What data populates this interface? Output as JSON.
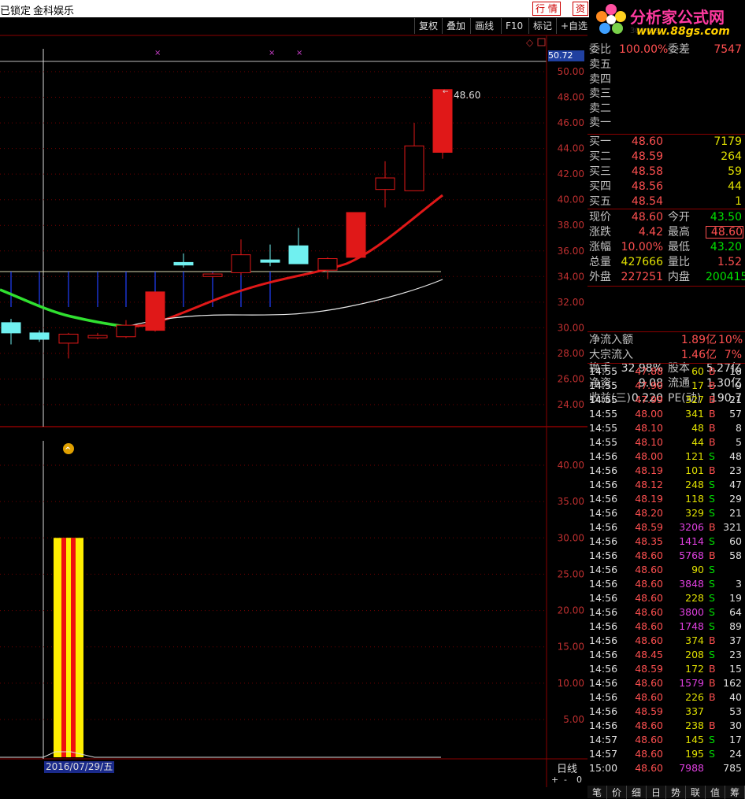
{
  "topbar": {
    "lock_text": "已锁定",
    "stock_name": "金科娱乐",
    "quote_btn": "行 情",
    "info_btn": "资"
  },
  "logo": {
    "title": "分析家公式网",
    "url": "www.88gs.com",
    "code": "300459"
  },
  "toolbar": {
    "items": [
      "复权",
      "叠加",
      "画线",
      "F10",
      "标记",
      "+自选"
    ]
  },
  "chart": {
    "indicator_value": "50.72",
    "last_price_label": "48.60",
    "price_axis": [
      "50.00",
      "48.00",
      "46.00",
      "44.00",
      "42.00",
      "40.00",
      "38.00",
      "36.00",
      "34.00",
      "32.00",
      "30.00",
      "28.00",
      "26.00",
      "24.00"
    ],
    "volume_axis": [
      "40.00",
      "35.00",
      "30.00",
      "25.00",
      "20.00",
      "15.00",
      "10.00",
      "5.00"
    ],
    "date_label": "2016/07/29/五",
    "period_label": "日线",
    "zoom_plus": "+",
    "zoom_minus": "-",
    "zoom_zero": "0"
  },
  "chart_data": {
    "type": "candlestick",
    "ylim": [
      22.5,
      51
    ],
    "candles": [
      {
        "o": 29.6,
        "c": 30.4,
        "h": 30.7,
        "l": 28.7,
        "color": "cyan"
      },
      {
        "o": 29.1,
        "c": 29.6,
        "h": 29.8,
        "l": 28.9,
        "color": "cyan"
      },
      {
        "o": 28.8,
        "c": 29.5,
        "h": 29.6,
        "l": 27.6,
        "color": "red-hollow"
      },
      {
        "o": 29.3,
        "c": 29.4,
        "h": 29.6,
        "l": 29.1,
        "color": "red-hollow"
      },
      {
        "o": 29.3,
        "c": 30.2,
        "h": 30.6,
        "l": 29.2,
        "color": "red-hollow"
      },
      {
        "o": 29.8,
        "c": 32.8,
        "h": 32.8,
        "l": 29.7,
        "color": "red-solid"
      },
      {
        "o": 34.9,
        "c": 35.1,
        "h": 35.8,
        "l": 34.7,
        "color": "cyan"
      },
      {
        "o": 34.0,
        "c": 34.2,
        "h": 34.3,
        "l": 33.9,
        "color": "red-hollow"
      },
      {
        "o": 34.3,
        "c": 35.7,
        "h": 36.9,
        "l": 34.1,
        "color": "red-hollow"
      },
      {
        "o": 35.2,
        "c": 35.3,
        "h": 36.5,
        "l": 34.8,
        "color": "cyan"
      },
      {
        "o": 35.0,
        "c": 36.4,
        "h": 37.8,
        "l": 35.0,
        "color": "cyan"
      },
      {
        "o": 34.5,
        "c": 35.4,
        "h": 35.5,
        "l": 33.8,
        "color": "red-hollow"
      },
      {
        "o": 35.5,
        "c": 39.0,
        "h": 39.0,
        "l": 35.4,
        "color": "red-solid"
      },
      {
        "o": 40.8,
        "c": 41.7,
        "h": 43.0,
        "l": 39.4,
        "color": "red-hollow"
      },
      {
        "o": 40.7,
        "c": 44.2,
        "h": 46.0,
        "l": 40.7,
        "color": "red-hollow"
      },
      {
        "o": 43.7,
        "c": 48.6,
        "h": 48.6,
        "l": 43.2,
        "color": "red-solid"
      }
    ],
    "volume": [
      {
        "value": 30.0,
        "colors": [
          "yellow",
          "red"
        ]
      }
    ]
  },
  "orderbook": {
    "ratio_label": "委比",
    "ratio_value": "100.00%",
    "diff_label": "委差",
    "diff_value": "7547",
    "sells": [
      {
        "label": "卖五",
        "price": "",
        "vol": ""
      },
      {
        "label": "卖四",
        "price": "",
        "vol": ""
      },
      {
        "label": "卖三",
        "price": "",
        "vol": ""
      },
      {
        "label": "卖二",
        "price": "",
        "vol": ""
      },
      {
        "label": "卖一",
        "price": "",
        "vol": ""
      }
    ],
    "buys": [
      {
        "label": "买一",
        "price": "48.60",
        "vol": "7179"
      },
      {
        "label": "买二",
        "price": "48.59",
        "vol": "264"
      },
      {
        "label": "买三",
        "price": "48.58",
        "vol": "59"
      },
      {
        "label": "买四",
        "price": "48.56",
        "vol": "44"
      },
      {
        "label": "买五",
        "price": "48.54",
        "vol": "1"
      }
    ]
  },
  "stats": [
    {
      "l1": "现价",
      "v1": "48.60",
      "c1": "red",
      "l2": "今开",
      "v2": "43.50",
      "c2": "green"
    },
    {
      "l1": "涨跌",
      "v1": "4.42",
      "c1": "red",
      "l2": "最高",
      "v2": "48.60",
      "c2": "red"
    },
    {
      "l1": "涨幅",
      "v1": "10.00%",
      "c1": "red",
      "l2": "最低",
      "v2": "43.20",
      "c2": "green"
    },
    {
      "l1": "总量",
      "v1": "427666",
      "c1": "yellow",
      "l2": "量比",
      "v2": "1.52",
      "c2": "red"
    },
    {
      "l1": "外盘",
      "v1": "227251",
      "c1": "red",
      "l2": "内盘",
      "v2": "200415",
      "c2": "green"
    },
    {
      "l1": "换手",
      "v1": "32.98%",
      "c1": "white",
      "l2": "股本",
      "v2": "5.27亿",
      "c2": "white"
    },
    {
      "l1": "净资",
      "v1": "9.08",
      "c1": "white",
      "l2": "流通",
      "v2": "1.30亿",
      "c2": "white"
    },
    {
      "l1": "收益(三)",
      "v1": "0.220",
      "c1": "white",
      "l2": "PE(动)",
      "v2": "190.7",
      "c2": "white"
    }
  ],
  "flows": [
    {
      "label": "净流入额",
      "value": "1.89亿",
      "pct": "10%"
    },
    {
      "label": "大宗流入",
      "value": "1.46亿",
      "pct": "7%"
    }
  ],
  "ticks": [
    {
      "t": "14:55",
      "p": "47.88",
      "v": "60",
      "s": "B",
      "n": "18",
      "vc": "yellow"
    },
    {
      "t": "14:55",
      "p": "47.90",
      "v": "17",
      "s": "B",
      "n": "9",
      "vc": "yellow"
    },
    {
      "t": "14:55",
      "p": "47.99",
      "v": "327",
      "s": "B",
      "n": "21",
      "vc": "yellow"
    },
    {
      "t": "14:55",
      "p": "48.00",
      "v": "341",
      "s": "B",
      "n": "57",
      "vc": "yellow"
    },
    {
      "t": "14:55",
      "p": "48.10",
      "v": "48",
      "s": "B",
      "n": "8",
      "vc": "yellow"
    },
    {
      "t": "14:55",
      "p": "48.10",
      "v": "44",
      "s": "B",
      "n": "5",
      "vc": "yellow"
    },
    {
      "t": "14:56",
      "p": "48.00",
      "v": "121",
      "s": "S",
      "n": "48",
      "vc": "yellow"
    },
    {
      "t": "14:56",
      "p": "48.19",
      "v": "101",
      "s": "B",
      "n": "23",
      "vc": "yellow"
    },
    {
      "t": "14:56",
      "p": "48.12",
      "v": "248",
      "s": "S",
      "n": "47",
      "vc": "yellow"
    },
    {
      "t": "14:56",
      "p": "48.19",
      "v": "118",
      "s": "S",
      "n": "29",
      "vc": "yellow"
    },
    {
      "t": "14:56",
      "p": "48.20",
      "v": "329",
      "s": "S",
      "n": "21",
      "vc": "yellow"
    },
    {
      "t": "14:56",
      "p": "48.59",
      "v": "3206",
      "s": "B",
      "n": "321",
      "vc": "mag"
    },
    {
      "t": "14:56",
      "p": "48.35",
      "v": "1414",
      "s": "S",
      "n": "60",
      "vc": "mag"
    },
    {
      "t": "14:56",
      "p": "48.60",
      "v": "5768",
      "s": "B",
      "n": "58",
      "vc": "mag"
    },
    {
      "t": "14:56",
      "p": "48.60",
      "v": "90",
      "s": "S",
      "n": "",
      "vc": "yellow"
    },
    {
      "t": "14:56",
      "p": "48.60",
      "v": "3848",
      "s": "S",
      "n": "3",
      "vc": "mag"
    },
    {
      "t": "14:56",
      "p": "48.60",
      "v": "228",
      "s": "S",
      "n": "19",
      "vc": "yellow"
    },
    {
      "t": "14:56",
      "p": "48.60",
      "v": "3800",
      "s": "S",
      "n": "64",
      "vc": "mag"
    },
    {
      "t": "14:56",
      "p": "48.60",
      "v": "1748",
      "s": "S",
      "n": "89",
      "vc": "mag"
    },
    {
      "t": "14:56",
      "p": "48.60",
      "v": "374",
      "s": "B",
      "n": "37",
      "vc": "yellow"
    },
    {
      "t": "14:56",
      "p": "48.45",
      "v": "208",
      "s": "S",
      "n": "23",
      "vc": "yellow"
    },
    {
      "t": "14:56",
      "p": "48.59",
      "v": "172",
      "s": "B",
      "n": "15",
      "vc": "yellow"
    },
    {
      "t": "14:56",
      "p": "48.60",
      "v": "1579",
      "s": "B",
      "n": "162",
      "vc": "mag"
    },
    {
      "t": "14:56",
      "p": "48.60",
      "v": "226",
      "s": "B",
      "n": "40",
      "vc": "yellow"
    },
    {
      "t": "14:56",
      "p": "48.59",
      "v": "337",
      "s": "",
      "n": "53",
      "vc": "yellow"
    },
    {
      "t": "14:56",
      "p": "48.60",
      "v": "238",
      "s": "B",
      "n": "30",
      "vc": "yellow"
    },
    {
      "t": "14:57",
      "p": "48.60",
      "v": "145",
      "s": "S",
      "n": "17",
      "vc": "yellow"
    },
    {
      "t": "14:57",
      "p": "48.60",
      "v": "195",
      "s": "S",
      "n": "24",
      "vc": "yellow"
    },
    {
      "t": "15:00",
      "p": "48.60",
      "v": "7988",
      "s": "",
      "n": "785",
      "vc": "mag"
    }
  ],
  "bottom_tabs": [
    "笔",
    "价",
    "细",
    "日",
    "势",
    "联",
    "值",
    "筹"
  ]
}
